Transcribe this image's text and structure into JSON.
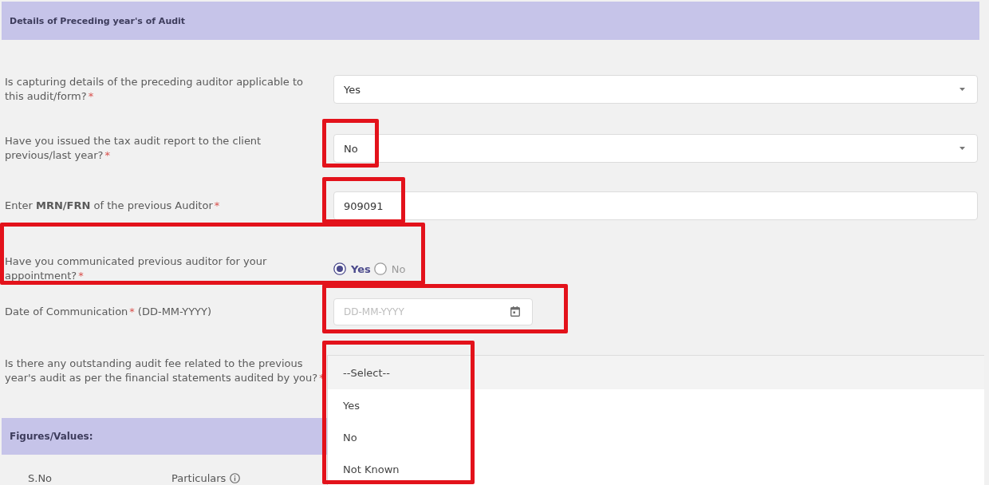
{
  "section": {
    "title": "Details of Preceding year's of Audit"
  },
  "rows": [
    {
      "kind": "select",
      "label": "Is capturing details of the preceding auditor applicable to this audit/form?",
      "required_mark": "*",
      "value": "Yes",
      "expanded": false,
      "highlighted": false
    },
    {
      "kind": "select",
      "label": "Have you issued the tax audit report to the client previous/last year?",
      "required_mark": "*",
      "value": "No",
      "expanded": false,
      "highlighted": true
    },
    {
      "kind": "text",
      "label": "Enter **MRN/FRN** of the previous Auditor",
      "required_mark": "*",
      "value": "909091",
      "highlighted": true
    },
    {
      "kind": "radio",
      "label": "Have you communicated previous auditor for your appointment?",
      "required_mark": "*",
      "options": [
        {
          "label": "Yes",
          "selected": true
        },
        {
          "label": "No",
          "selected": false
        }
      ],
      "highlighted": true
    },
    {
      "kind": "date",
      "label": "Date of Communication",
      "required_mark": "*",
      "hint": "(DD-MM-YYYY)",
      "placeholder": "DD-MM-YYYY",
      "highlighted": true
    },
    {
      "kind": "select",
      "label": "Is there any outstanding audit fee related to the previous year's audit as per the financial statements audited by you?",
      "required_mark": "*",
      "expanded": true,
      "options": [
        {
          "label": "--Select--",
          "selected": true
        },
        {
          "label": "Yes",
          "selected": false
        },
        {
          "label": "No",
          "selected": false
        },
        {
          "label": "Not Known",
          "selected": false
        }
      ],
      "highlighted": true
    }
  ],
  "figures": {
    "title": "Figures/Values:",
    "columns": [
      "S.No",
      "Particulars"
    ]
  }
}
